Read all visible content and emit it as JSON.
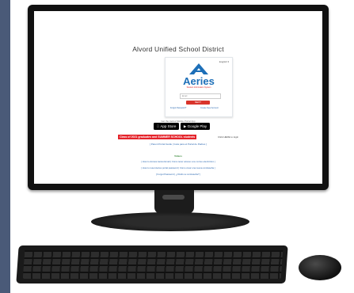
{
  "district_title": "Alvord Unified School District",
  "login": {
    "language": "English",
    "brand": "Aeries",
    "tagline": "Student Information System",
    "email_placeholder": "Email",
    "next_label": "NEXT",
    "forgot_password": "Forgot Password?",
    "create_account": "Create New Account"
  },
  "mobile_text": "Get the Aeries Mobile Portal App",
  "app_store_label": "App Store",
  "google_play_label": "Google Play",
  "grad_banner": "Class of 2021 graduates and SUMMER SCHOOL students",
  "grad_extra": "Click HERE to login",
  "parent_portal": "[ Parent Portal Guide | Guía para el Portal de Padres ]",
  "video_label": "Videos",
  "help_lines": [
    "[ How to Access Aeries Email | Cómo tener acceso a su correo electrónico ]",
    "[ How to reset Aeries portal password | Cómo crear una nueva contraseña ]",
    "[ Forgot Password | ¿Olvidó su contraseña? ]"
  ],
  "colors": {
    "aeries_blue": "#1d6fb8",
    "accent_red": "#d9342b"
  }
}
